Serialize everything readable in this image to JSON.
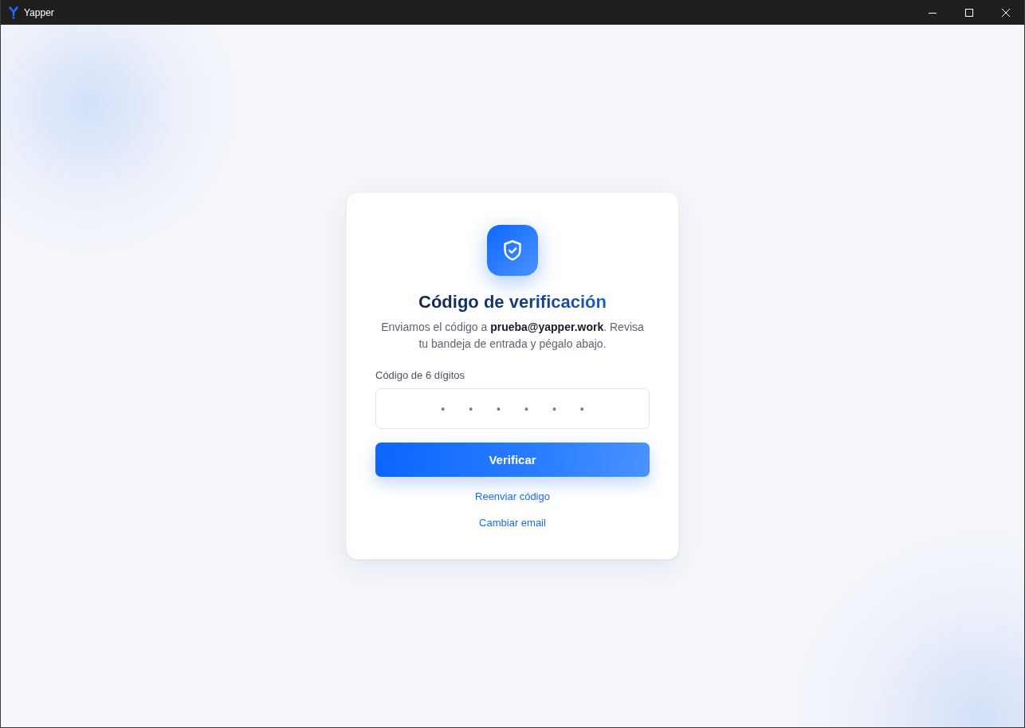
{
  "window": {
    "title": "Yapper"
  },
  "card": {
    "title": "Código de verificación",
    "description": "Enviamos el código a **prueba@yapper.work**. Revisa tu bandeja de entrada y pégalo abajo.",
    "code_field": {
      "label": "Código de 6 dígitos",
      "placeholder": "••••••"
    },
    "actions": [
      {
        "kind": "primary",
        "label": "Verificar"
      },
      {
        "kind": "link",
        "label": "Reenviar código"
      },
      {
        "kind": "link",
        "label": "Cambiar email"
      }
    ]
  }
}
